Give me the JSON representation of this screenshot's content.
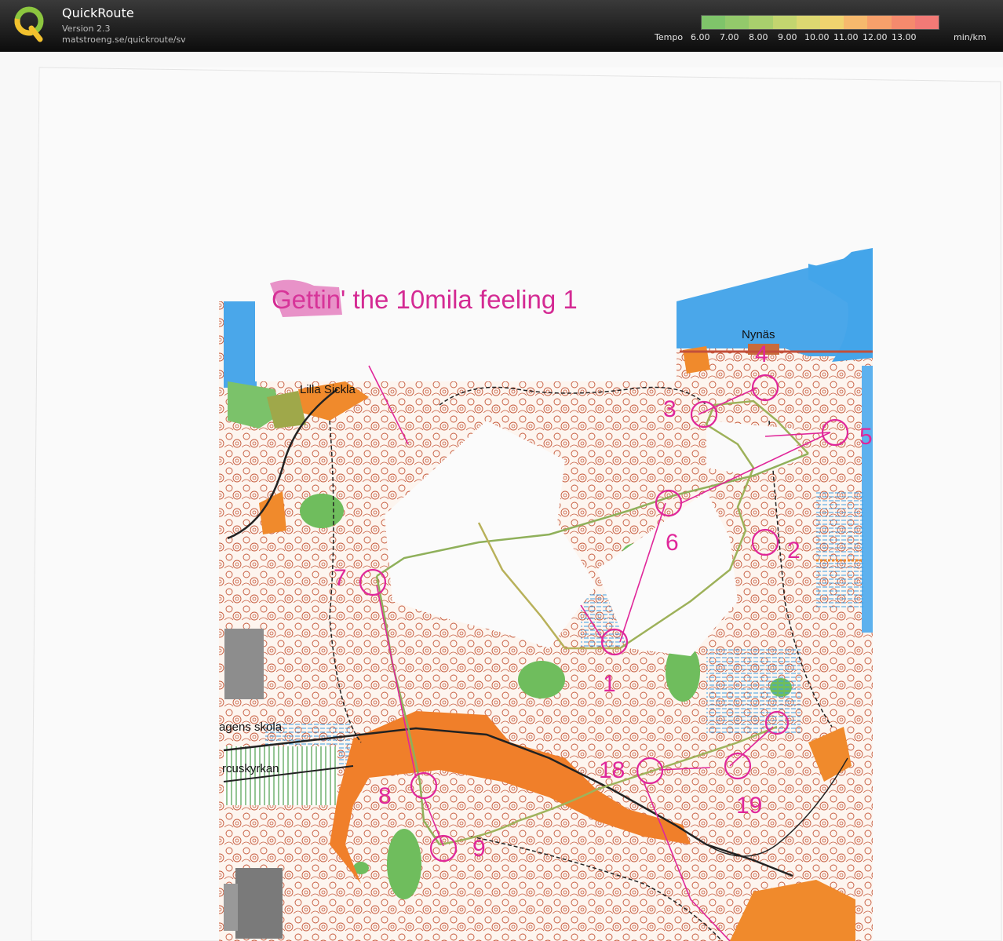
{
  "app": {
    "name": "QuickRoute",
    "version": "Version 2.3",
    "url": "matstroeng.se/quickroute/sv"
  },
  "legend": {
    "label": "Tempo",
    "ticks": [
      "6.00",
      "7.00",
      "8.00",
      "9.00",
      "10.00",
      "11.00",
      "12.00",
      "13.00"
    ],
    "unit": "min/km",
    "colors": [
      "#7fc46a",
      "#93c96b",
      "#a9cf6d",
      "#c3d56f",
      "#dcd871",
      "#f0d36f",
      "#f6b96d",
      "#f7a06b",
      "#f58a6d",
      "#f27a76"
    ]
  },
  "map": {
    "title": "Gettin' the 10mila feeling 1",
    "place_names": {
      "nynas": "Nynäs",
      "lilla_sickla": "Lilla Sickla",
      "skola": "agens skola",
      "kyrkan": "rcuskyrkan"
    },
    "controls": [
      "1",
      "2",
      "3",
      "4",
      "5",
      "6",
      "7",
      "8",
      "9",
      "18",
      "19"
    ],
    "colors": {
      "paper": "#f9f9f9",
      "map_bg": "#fcf6f1",
      "contour": "#c0452a",
      "water": "#55aaee",
      "green": "#5db55a",
      "orange": "#f08a2c",
      "course": "#e0279a",
      "route": "#8dae55",
      "track": "#222222"
    }
  }
}
